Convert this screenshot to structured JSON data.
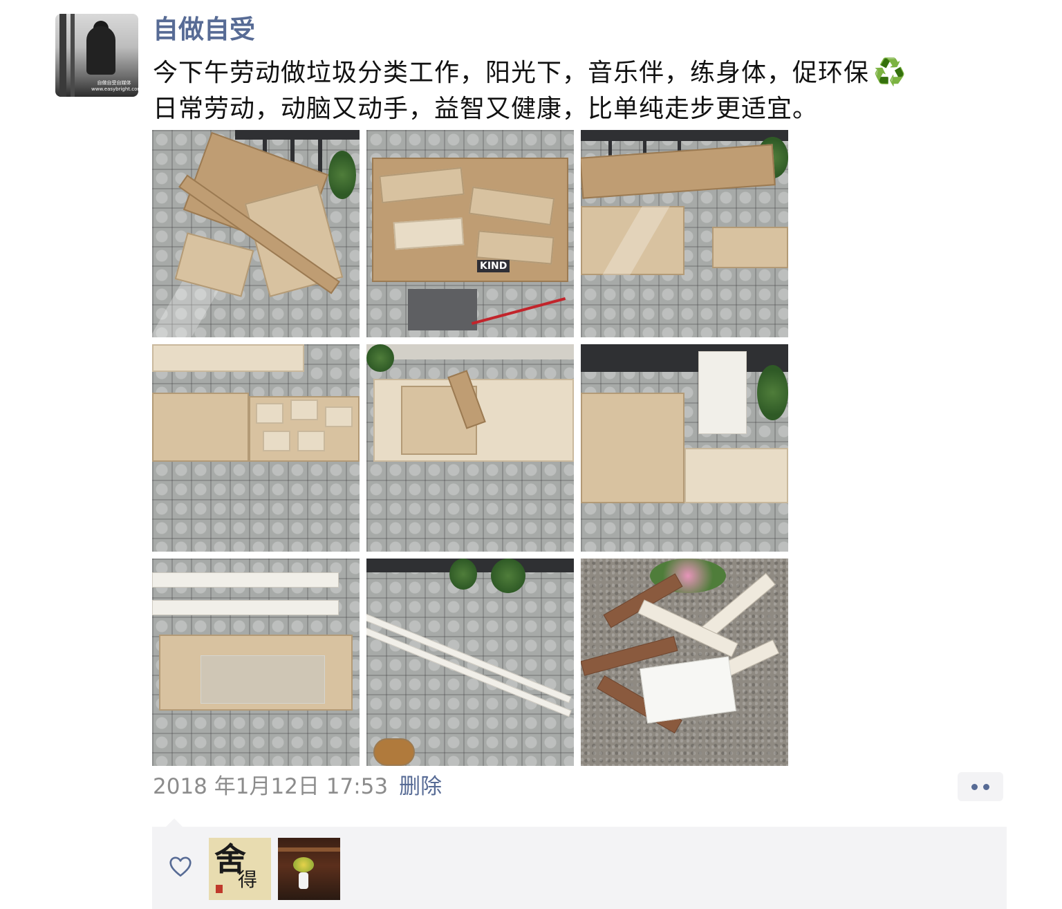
{
  "post": {
    "username": "自做自受",
    "avatar_watermark_line1": "自做自受自媒体",
    "avatar_watermark_line2": "www.easybright.com",
    "content_line1": "今下午劳动做垃圾分类工作，阳光下，音乐伴，练身体，促环保",
    "content_line1_icon": "♻️",
    "content_line2": "日常劳动，动脑又动手，益智又健康，比单纯走步更适宜。",
    "photos": [
      {
        "name": "photo-1",
        "brand_label": ""
      },
      {
        "name": "photo-2",
        "brand_label": "KIND"
      },
      {
        "name": "photo-3",
        "brand_label": ""
      },
      {
        "name": "photo-4",
        "brand_label": ""
      },
      {
        "name": "photo-5",
        "brand_label": ""
      },
      {
        "name": "photo-6",
        "brand_label": ""
      },
      {
        "name": "photo-7",
        "brand_label": ""
      },
      {
        "name": "photo-8",
        "brand_label": ""
      },
      {
        "name": "photo-9",
        "brand_label": ""
      }
    ],
    "timestamp": "2018 年1月12日 17:53",
    "delete_label": "删除",
    "more_icon": "more-dots-icon"
  },
  "likes": {
    "icon": "heart-outline-icon",
    "likers": [
      {
        "name": "liker-avatar-1",
        "calligraphy_main": "舍",
        "calligraphy_sub": "得"
      },
      {
        "name": "liker-avatar-2"
      }
    ]
  },
  "colors": {
    "link": "#576b95",
    "meta_gray": "#8c8c8c",
    "likes_bg": "#f3f3f5",
    "recycle_green": "#21a33a"
  }
}
